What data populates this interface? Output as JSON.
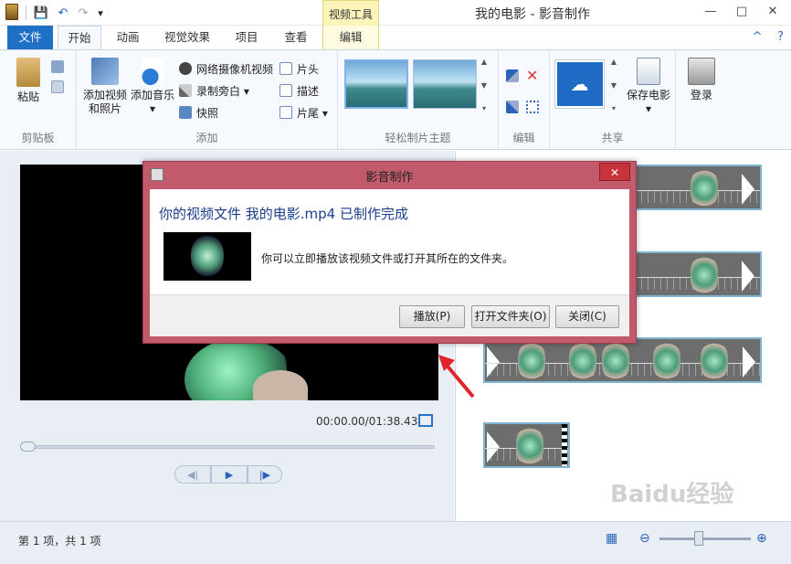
{
  "window": {
    "title": "我的电影 - 影音制作",
    "context_tab_group": "视频工具",
    "controls": {
      "minimize": "—",
      "maximize": "□",
      "close": "✕"
    }
  },
  "quick_access": {
    "save": "💾",
    "undo": "↶",
    "redo": "↷",
    "dropdown": "▾"
  },
  "tabs": {
    "file": "文件",
    "home": "开始",
    "animation": "动画",
    "visual_effects": "视觉效果",
    "project": "项目",
    "view": "查看",
    "edit": "编辑"
  },
  "help": {
    "collapse": "^",
    "help": "?"
  },
  "ribbon": {
    "clipboard": {
      "paste": "粘贴",
      "label": "剪贴板"
    },
    "add": {
      "add_video_line1": "添加视频",
      "add_video_line2": "和照片",
      "add_music": "添加音乐",
      "add_music_arrow": "▾",
      "webcam_video": "网络摄像机视频",
      "record_narration": "录制旁白 ▾",
      "snapshot": "快照",
      "title": "片头",
      "caption": "描述",
      "credits": "片尾 ▾",
      "label": "添加"
    },
    "themes": {
      "label": "轻松制片主题"
    },
    "editing": {
      "label": "编辑"
    },
    "share": {
      "save_movie": "保存电影",
      "save_arrow": "▾",
      "label": "共享"
    },
    "signin": {
      "label": "登录"
    }
  },
  "preview": {
    "timecode": "00:00.00/01:38.43",
    "controls": {
      "prev": "◀|",
      "play": "▶",
      "next": "|▶"
    }
  },
  "status": {
    "items": "第 1 项，共 1 项",
    "watermark": "Baidu经验"
  },
  "dialog": {
    "title": "影音制作",
    "close": "✕",
    "heading": "你的视频文件 我的电影.mp4 已制作完成",
    "message": "你可以立即播放该视频文件或打开其所在的文件夹。",
    "buttons": {
      "play": "播放(P)",
      "open_folder": "打开文件夹(O)",
      "close": "关闭(C)"
    }
  },
  "colors": {
    "file_tab": "#1f6fc4",
    "dialog_frame": "#c15b6b",
    "close_button": "#c7343b",
    "annotation_arrow": "#e0242b"
  }
}
